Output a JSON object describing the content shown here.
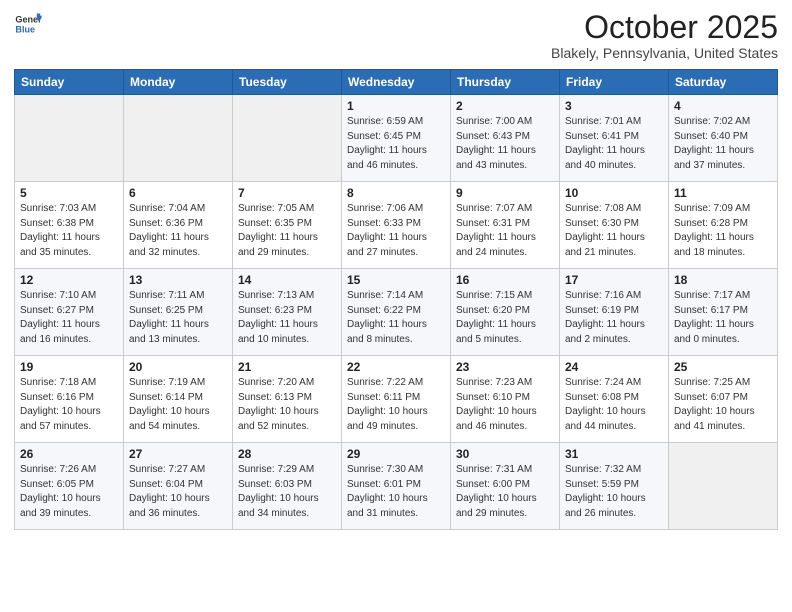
{
  "header": {
    "title": "October 2025",
    "subtitle": "Blakely, Pennsylvania, United States"
  },
  "calendar": {
    "days": [
      "Sunday",
      "Monday",
      "Tuesday",
      "Wednesday",
      "Thursday",
      "Friday",
      "Saturday"
    ],
    "weeks": [
      [
        {
          "num": "",
          "info": ""
        },
        {
          "num": "",
          "info": ""
        },
        {
          "num": "",
          "info": ""
        },
        {
          "num": "1",
          "info": "Sunrise: 6:59 AM\nSunset: 6:45 PM\nDaylight: 11 hours\nand 46 minutes."
        },
        {
          "num": "2",
          "info": "Sunrise: 7:00 AM\nSunset: 6:43 PM\nDaylight: 11 hours\nand 43 minutes."
        },
        {
          "num": "3",
          "info": "Sunrise: 7:01 AM\nSunset: 6:41 PM\nDaylight: 11 hours\nand 40 minutes."
        },
        {
          "num": "4",
          "info": "Sunrise: 7:02 AM\nSunset: 6:40 PM\nDaylight: 11 hours\nand 37 minutes."
        }
      ],
      [
        {
          "num": "5",
          "info": "Sunrise: 7:03 AM\nSunset: 6:38 PM\nDaylight: 11 hours\nand 35 minutes."
        },
        {
          "num": "6",
          "info": "Sunrise: 7:04 AM\nSunset: 6:36 PM\nDaylight: 11 hours\nand 32 minutes."
        },
        {
          "num": "7",
          "info": "Sunrise: 7:05 AM\nSunset: 6:35 PM\nDaylight: 11 hours\nand 29 minutes."
        },
        {
          "num": "8",
          "info": "Sunrise: 7:06 AM\nSunset: 6:33 PM\nDaylight: 11 hours\nand 27 minutes."
        },
        {
          "num": "9",
          "info": "Sunrise: 7:07 AM\nSunset: 6:31 PM\nDaylight: 11 hours\nand 24 minutes."
        },
        {
          "num": "10",
          "info": "Sunrise: 7:08 AM\nSunset: 6:30 PM\nDaylight: 11 hours\nand 21 minutes."
        },
        {
          "num": "11",
          "info": "Sunrise: 7:09 AM\nSunset: 6:28 PM\nDaylight: 11 hours\nand 18 minutes."
        }
      ],
      [
        {
          "num": "12",
          "info": "Sunrise: 7:10 AM\nSunset: 6:27 PM\nDaylight: 11 hours\nand 16 minutes."
        },
        {
          "num": "13",
          "info": "Sunrise: 7:11 AM\nSunset: 6:25 PM\nDaylight: 11 hours\nand 13 minutes."
        },
        {
          "num": "14",
          "info": "Sunrise: 7:13 AM\nSunset: 6:23 PM\nDaylight: 11 hours\nand 10 minutes."
        },
        {
          "num": "15",
          "info": "Sunrise: 7:14 AM\nSunset: 6:22 PM\nDaylight: 11 hours\nand 8 minutes."
        },
        {
          "num": "16",
          "info": "Sunrise: 7:15 AM\nSunset: 6:20 PM\nDaylight: 11 hours\nand 5 minutes."
        },
        {
          "num": "17",
          "info": "Sunrise: 7:16 AM\nSunset: 6:19 PM\nDaylight: 11 hours\nand 2 minutes."
        },
        {
          "num": "18",
          "info": "Sunrise: 7:17 AM\nSunset: 6:17 PM\nDaylight: 11 hours\nand 0 minutes."
        }
      ],
      [
        {
          "num": "19",
          "info": "Sunrise: 7:18 AM\nSunset: 6:16 PM\nDaylight: 10 hours\nand 57 minutes."
        },
        {
          "num": "20",
          "info": "Sunrise: 7:19 AM\nSunset: 6:14 PM\nDaylight: 10 hours\nand 54 minutes."
        },
        {
          "num": "21",
          "info": "Sunrise: 7:20 AM\nSunset: 6:13 PM\nDaylight: 10 hours\nand 52 minutes."
        },
        {
          "num": "22",
          "info": "Sunrise: 7:22 AM\nSunset: 6:11 PM\nDaylight: 10 hours\nand 49 minutes."
        },
        {
          "num": "23",
          "info": "Sunrise: 7:23 AM\nSunset: 6:10 PM\nDaylight: 10 hours\nand 46 minutes."
        },
        {
          "num": "24",
          "info": "Sunrise: 7:24 AM\nSunset: 6:08 PM\nDaylight: 10 hours\nand 44 minutes."
        },
        {
          "num": "25",
          "info": "Sunrise: 7:25 AM\nSunset: 6:07 PM\nDaylight: 10 hours\nand 41 minutes."
        }
      ],
      [
        {
          "num": "26",
          "info": "Sunrise: 7:26 AM\nSunset: 6:05 PM\nDaylight: 10 hours\nand 39 minutes."
        },
        {
          "num": "27",
          "info": "Sunrise: 7:27 AM\nSunset: 6:04 PM\nDaylight: 10 hours\nand 36 minutes."
        },
        {
          "num": "28",
          "info": "Sunrise: 7:29 AM\nSunset: 6:03 PM\nDaylight: 10 hours\nand 34 minutes."
        },
        {
          "num": "29",
          "info": "Sunrise: 7:30 AM\nSunset: 6:01 PM\nDaylight: 10 hours\nand 31 minutes."
        },
        {
          "num": "30",
          "info": "Sunrise: 7:31 AM\nSunset: 6:00 PM\nDaylight: 10 hours\nand 29 minutes."
        },
        {
          "num": "31",
          "info": "Sunrise: 7:32 AM\nSunset: 5:59 PM\nDaylight: 10 hours\nand 26 minutes."
        },
        {
          "num": "",
          "info": ""
        }
      ]
    ]
  }
}
